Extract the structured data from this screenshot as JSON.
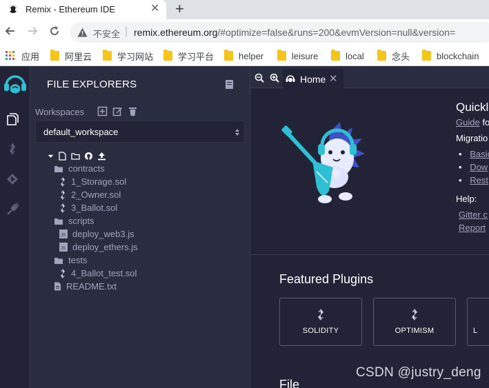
{
  "browser": {
    "tab_title": "Remix - Ethereum IDE",
    "tab_close": "✕",
    "new_tab": "+",
    "insecure_label": "不安全",
    "url_host": "remix.ethereum.org",
    "url_rest": "/#optimize=false&runs=200&evmVersion=null&version=",
    "bookmarks": [
      "应用",
      "阿里云",
      "学习网站",
      "学习平台",
      "helper",
      "leisure",
      "local",
      "念头",
      "blockchain"
    ]
  },
  "icons": {
    "back": "back-arrow-icon",
    "forward": "forward-arrow-icon",
    "reload": "reload-icon",
    "insecure": "warning-triangle-icon",
    "apps": "apps-grid-icon",
    "folder": "folder-icon",
    "file": "file-icon",
    "solidity": "solidity-icon",
    "js": "javascript-file-icon"
  },
  "colors": {
    "accent": "#2fbfd4",
    "panel": "#2a2c3f",
    "dark": "#222336",
    "text_muted": "#a2a3bd"
  },
  "sidepanel": {
    "title": "FILE EXPLORERS",
    "workspaces_label": "Workspaces",
    "workspace_selected": "default_workspace",
    "tree": [
      {
        "name": "contracts",
        "type": "folder",
        "depth": 0
      },
      {
        "name": "1_Storage.sol",
        "type": "sol",
        "depth": 1
      },
      {
        "name": "2_Owner.sol",
        "type": "sol",
        "depth": 1
      },
      {
        "name": "3_Ballot.sol",
        "type": "sol",
        "depth": 1
      },
      {
        "name": "scripts",
        "type": "folder",
        "depth": 0
      },
      {
        "name": "deploy_web3.js",
        "type": "js",
        "depth": 1
      },
      {
        "name": "deploy_ethers.js",
        "type": "js",
        "depth": 1
      },
      {
        "name": "tests",
        "type": "folder",
        "depth": 0
      },
      {
        "name": "4_Ballot_test.sol",
        "type": "sol",
        "depth": 1
      },
      {
        "name": "README.txt",
        "type": "file",
        "depth": 0
      }
    ]
  },
  "main": {
    "home_tab": "Home",
    "home_close": "✕",
    "quick_title": "Quickl",
    "guide_link": "Guide",
    "guide_suffix": "fo",
    "migration_label": "Migratio",
    "migration_links": [
      "Basic",
      "Dow",
      "Rest"
    ],
    "help_label": "Help:",
    "help_links": [
      "Gitter c",
      "Report"
    ],
    "featured_title": "Featured Plugins",
    "plugins": [
      "SOLIDITY",
      "OPTIMISM",
      "L"
    ],
    "file_title": "File"
  },
  "watermark": "CSDN @justry_deng"
}
